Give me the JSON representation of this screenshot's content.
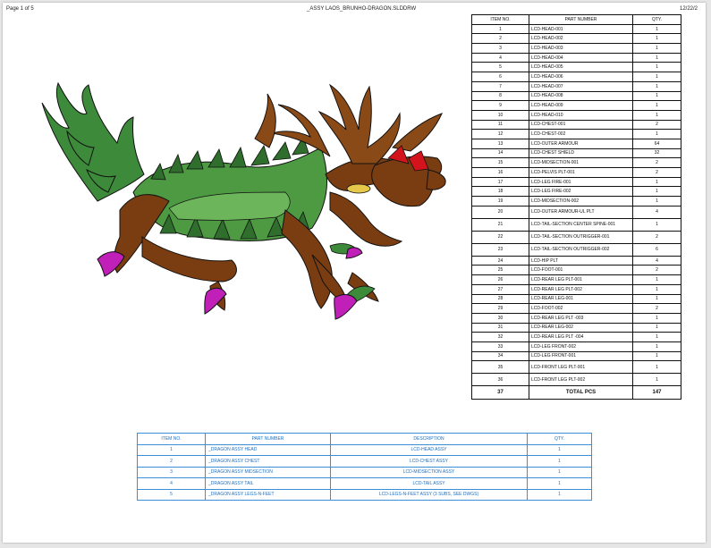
{
  "viewer": {
    "page_label": "Page 1 of 5",
    "file_name": "_ASSY LAOS_BRUNHO-DRAGON.SLDDRW",
    "date": "12/22/2"
  },
  "bom_parts": {
    "headers": [
      "ITEM NO.",
      "PART NUMBER",
      "QTY."
    ],
    "rows": [
      {
        "item": "1",
        "part": "LCD-HEAD-001",
        "qty": "1"
      },
      {
        "item": "2",
        "part": "LCD-HEAD-002",
        "qty": "1"
      },
      {
        "item": "3",
        "part": "LCD-HEAD-003",
        "qty": "1"
      },
      {
        "item": "4",
        "part": "LCD-HEAD-004",
        "qty": "1"
      },
      {
        "item": "5",
        "part": "LCD-HEAD-005",
        "qty": "1"
      },
      {
        "item": "6",
        "part": "LCD-HEAD-006",
        "qty": "1"
      },
      {
        "item": "7",
        "part": "LCD-HEAD-007",
        "qty": "1"
      },
      {
        "item": "8",
        "part": "LCD-HEAD-008",
        "qty": "1"
      },
      {
        "item": "9",
        "part": "LCD-HEAD-009",
        "qty": "1"
      },
      {
        "item": "10",
        "part": "LCD-HEAD-010",
        "qty": "1"
      },
      {
        "item": "11",
        "part": "LCD-CHEST-001",
        "qty": "2"
      },
      {
        "item": "12",
        "part": "LCD-CHEST-002",
        "qty": "1"
      },
      {
        "item": "13",
        "part": "LCD-OUTER ARMOUR",
        "qty": "64"
      },
      {
        "item": "14",
        "part": "LCD-CHEST SHIELD",
        "qty": "32"
      },
      {
        "item": "15",
        "part": "LCD-MIDSECTION-001",
        "qty": "2"
      },
      {
        "item": "16",
        "part": "LCD-PELVIS PLT-001",
        "qty": "2"
      },
      {
        "item": "17",
        "part": "LCD-LEG FIRE-001",
        "qty": "1"
      },
      {
        "item": "18",
        "part": "LCD-LEG FIRE-002",
        "qty": "1"
      },
      {
        "item": "19",
        "part": "LCD-MIDSECTION-002",
        "qty": "1"
      },
      {
        "item": "20",
        "part": "LCD-OUTER ARMOUR-UL PLT",
        "qty": "4"
      },
      {
        "item": "21",
        "part": "LCD-TAIL-SECTION CENTER SPINE-001",
        "qty": "1"
      },
      {
        "item": "22",
        "part": "LCD-TAIL-SECTION OUTRIGGER-001",
        "qty": "2"
      },
      {
        "item": "23",
        "part": "LCD-TAIL-SECTION OUTRIGGER-002",
        "qty": "6"
      },
      {
        "item": "24",
        "part": "LCD-HIP PLT",
        "qty": "4"
      },
      {
        "item": "25",
        "part": "LCD-FOOT-001",
        "qty": "2"
      },
      {
        "item": "26",
        "part": "LCD-REAR LEG PLT-001",
        "qty": "1"
      },
      {
        "item": "27",
        "part": "LCD-REAR LEG PLT-002",
        "qty": "1"
      },
      {
        "item": "28",
        "part": "LCD-REAR LEG-001",
        "qty": "1"
      },
      {
        "item": "29",
        "part": "LCD-FOOT-002",
        "qty": "2"
      },
      {
        "item": "30",
        "part": "LCD-REAR LEG PLT -003",
        "qty": "1"
      },
      {
        "item": "31",
        "part": "LCD-REAR LEG-002",
        "qty": "1"
      },
      {
        "item": "32",
        "part": "LCD-REAR LEG PLT -004",
        "qty": "1"
      },
      {
        "item": "33",
        "part": "LCD-LEG FRONT-002",
        "qty": "1"
      },
      {
        "item": "34",
        "part": "LCD-LEG FRONT-001",
        "qty": "1"
      },
      {
        "item": "35",
        "part": "LCD-FRONT LEG PLT-001",
        "qty": "1"
      },
      {
        "item": "36",
        "part": "LCD-FRONT LEG PLT-002",
        "qty": "1"
      }
    ],
    "total": {
      "item": "37",
      "label": "TOTAL PCS",
      "qty": "147"
    }
  },
  "bom_assy": {
    "headers": [
      "ITEM NO.",
      "PART NUMBER",
      "DESCRIPTION",
      "QTY."
    ],
    "rows": [
      {
        "item": "1",
        "part": "_DRAGON ASSY HEAD",
        "desc": "LCD-HEAD ASSY",
        "qty": "1"
      },
      {
        "item": "2",
        "part": "_DRAGON ASSY CHEST",
        "desc": "LCD-CHEST ASSY",
        "qty": "1"
      },
      {
        "item": "3",
        "part": "_DRAGON ASSY MIDSECTION",
        "desc": "LCD-MIDSECTION ASSY",
        "qty": "1"
      },
      {
        "item": "4",
        "part": "_DRAGON ASSY TAIL",
        "desc": "LCD-TAIL ASSY",
        "qty": "1"
      },
      {
        "item": "5",
        "part": "_DRAGON ASSY LEGS-N-FEET",
        "desc": "LCD-LEGS-N-FEET ASSY (3 SUBS, SEE DWGS)",
        "qty": "1"
      }
    ]
  },
  "colors": {
    "table1_line": "#111111",
    "table2_line": "#3b8fd8",
    "table2_text": "#1e6fc0",
    "dragon_green": "#3d8a3a",
    "dragon_brown": "#7a3d12",
    "dragon_purple": "#c01fb8",
    "dragon_red": "#d4141c"
  },
  "drawing": {
    "subject": "dragon-assembly-illustration"
  }
}
